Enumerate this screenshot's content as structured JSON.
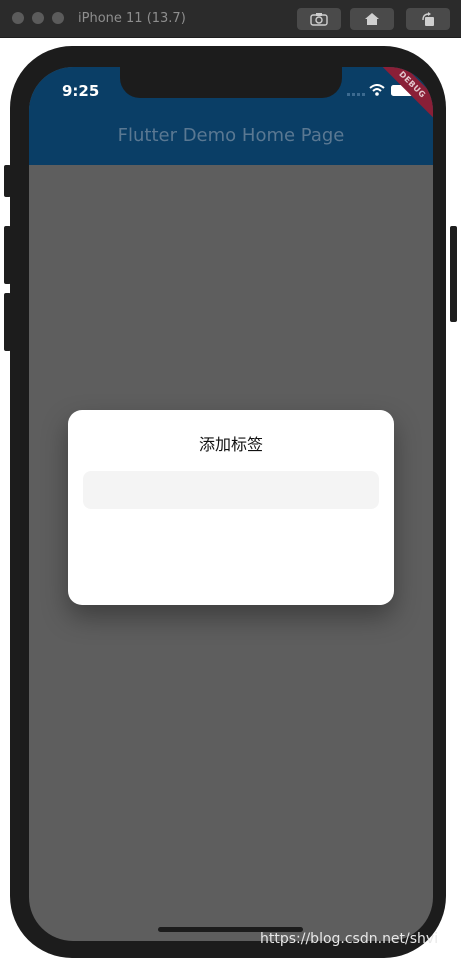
{
  "simulator": {
    "title": "iPhone 11 (13.7)",
    "buttons": [
      "screenshot-icon",
      "home-icon",
      "rotate-icon"
    ]
  },
  "status_bar": {
    "time": "9:25"
  },
  "app_bar": {
    "title": "Flutter Demo Home Page",
    "color": "#0a3e66"
  },
  "debug_banner": {
    "label": "DEBUG"
  },
  "dialog": {
    "title": "添加标签",
    "input_value": ""
  },
  "watermark": {
    "text": "https://blog.csdn.net/shvi"
  }
}
